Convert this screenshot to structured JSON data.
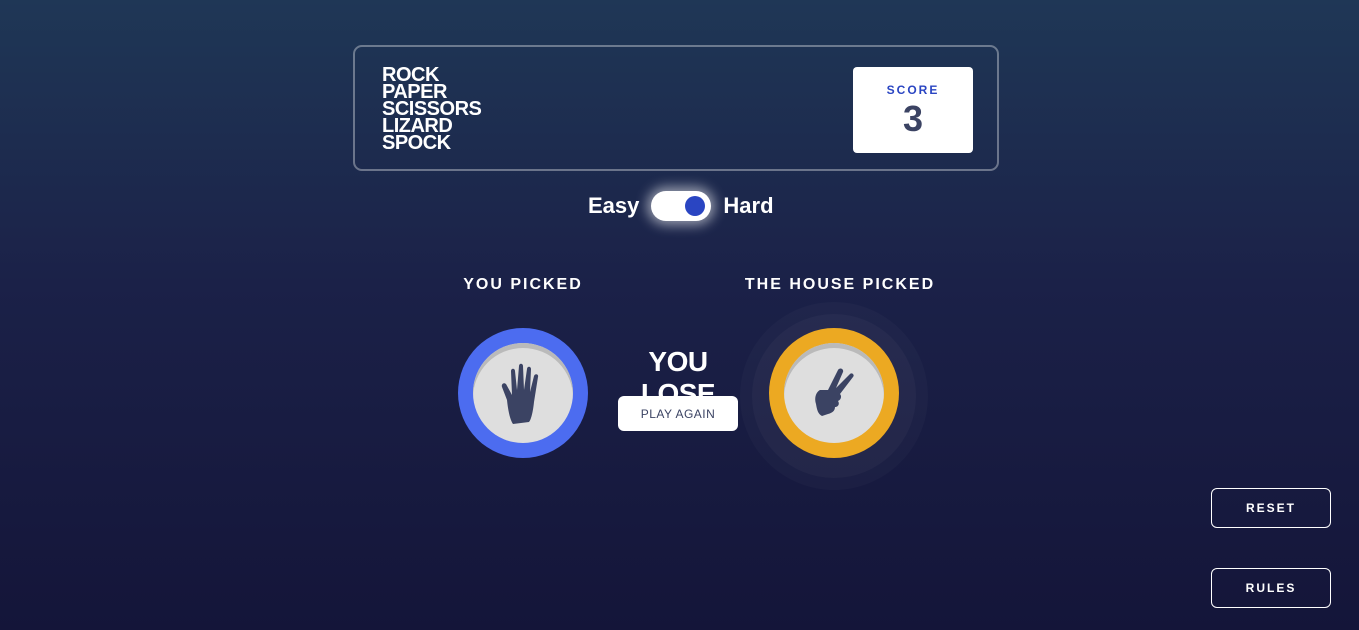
{
  "header": {
    "title_words": [
      "ROCK",
      "PAPER",
      "SCISSORS",
      "LIZARD",
      "SPOCK"
    ],
    "score_label": "SCORE",
    "score_value": "3"
  },
  "mode": {
    "easy_label": "Easy",
    "hard_label": "Hard",
    "selected": "Hard"
  },
  "game": {
    "player_title": "YOU PICKED",
    "house_title": "THE HOUSE PICKED",
    "player_pick": {
      "name": "paper",
      "icon": "paper-hand-icon",
      "color": "#4c6cf0"
    },
    "house_pick": {
      "name": "scissors",
      "icon": "scissors-hand-icon",
      "color": "#eca922"
    },
    "result_text": "YOU LOSE",
    "play_again_label": "PLAY AGAIN"
  },
  "controls": {
    "reset_label": "RESET",
    "rules_label": "RULES"
  },
  "colors": {
    "background_top": "#1f3756",
    "background_bottom": "#141539",
    "score_text": "#2a45c2",
    "icon_dark": "#3b4363"
  }
}
